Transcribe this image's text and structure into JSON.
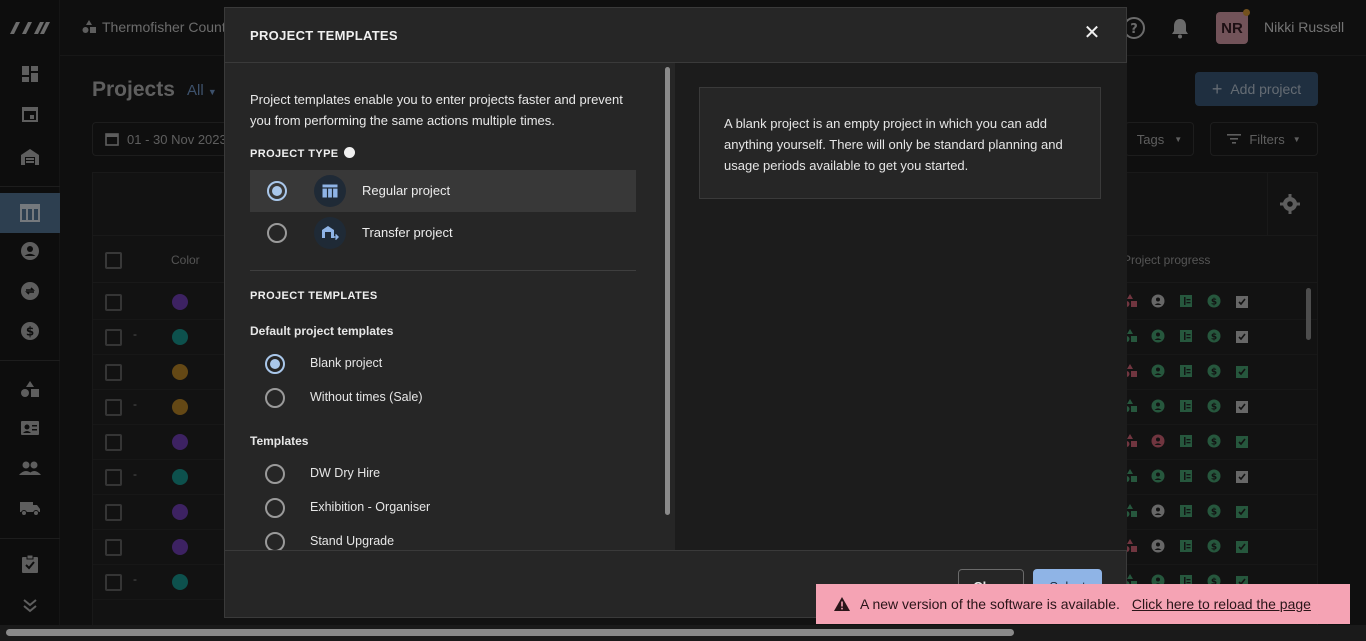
{
  "topbar": {
    "org_name": "Thermofisher Counte",
    "avatar_initials": "NR",
    "user_name": "Nikki Russell"
  },
  "page": {
    "title": "Projects",
    "filter_value": "All",
    "add_button": "Add project",
    "date_range": "01 - 30 Nov 2023",
    "tags_label": "Tags",
    "filters_label": "Filters",
    "columns": {
      "color": "Color",
      "progress": "Project progress"
    },
    "rows": [
      {
        "dash": "",
        "color": "#7a45c4"
      },
      {
        "dash": "-",
        "color": "#1aa39a"
      },
      {
        "dash": "",
        "color": "#c9902a"
      },
      {
        "dash": "-",
        "color": "#c9902a"
      },
      {
        "dash": "",
        "color": "#7a45c4"
      },
      {
        "dash": "-",
        "color": "#1aa39a"
      },
      {
        "dash": "",
        "color": "#7a45c4"
      },
      {
        "dash": "",
        "color": "#7a45c4"
      },
      {
        "dash": "-",
        "color": "#1aa39a"
      }
    ]
  },
  "modal": {
    "title": "PROJECT TEMPLATES",
    "intro": "Project templates enable you to enter projects faster and prevent you from performing the same actions multiple times.",
    "project_type_label": "PROJECT TYPE",
    "project_types": [
      {
        "label": "Regular project",
        "icon": "table-icon",
        "selected": true
      },
      {
        "label": "Transfer project",
        "icon": "transfer-icon",
        "selected": false
      }
    ],
    "templates_section_label": "PROJECT TEMPLATES",
    "default_templates_label": "Default project templates",
    "default_templates": [
      {
        "label": "Blank project",
        "selected": true
      },
      {
        "label": "Without times (Sale)",
        "selected": false
      }
    ],
    "templates_label": "Templates",
    "templates": [
      {
        "label": "DW Dry Hire"
      },
      {
        "label": "Exhibition - Organiser"
      },
      {
        "label": "Stand Upgrade"
      }
    ],
    "description": "A blank project is an empty project in which you can add anything yourself. There will only be standard planning and usage periods available to get you started.",
    "close_button": "Close",
    "select_button": "Select"
  },
  "toast": {
    "message": "A new version of the software is available.",
    "link": "Click here to reload the page"
  },
  "colors": {
    "accent": "#8fb4e6",
    "rail_active": "#5b7fa0",
    "toast_bg": "#f5a3b4",
    "progress_green": "#4caf7a",
    "progress_red": "#e06a7e"
  }
}
